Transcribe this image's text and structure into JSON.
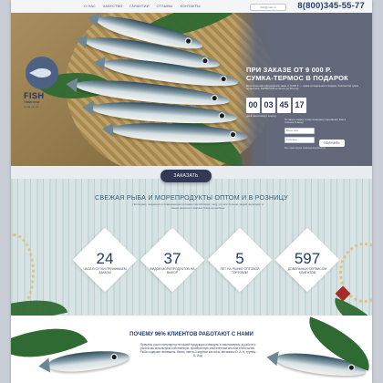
{
  "nav": [
    "О НАС",
    "КАЧЕСТВО",
    "ГАРАНТИИ",
    "ОТЗЫВЫ",
    "КОНТАКТЫ"
  ],
  "header": {
    "email": "fish@mail.ru",
    "phone": "8(800)345-55-77"
  },
  "logo": {
    "title": "FISH",
    "subtitle": "Навигатор",
    "tagline": "рыба оптом"
  },
  "offer": {
    "title_line1": "ПРИ ЗАКАЗЕ ОТ 9 000 Р.",
    "title_line2": "СУМКА-ТЕРМОС В ПОДАРОК",
    "text": "Всем клиентам оформившим заказ от 9 000 Р. — сумка-холодильник в подарок. Количество сумок ограничено. ТЕРМОСОВ осталось до 26 штук",
    "timer": [
      "00",
      "03",
      "45",
      "17"
    ],
    "timer_caption": "дней   часов   минут   секунд"
  },
  "form": {
    "note": "Оставьте заявку и наш менеджер перезвонит вам в течение 5 минут",
    "name_placeholder": "Ваше имя",
    "phone_placeholder": "Телефон",
    "submit": "ПОЛУЧИТЬ",
    "hint": "Мы гарантируем конфиденциальность"
  },
  "order_button": "ЗАКАЗАТЬ",
  "section": {
    "title": "СВЕЖАЯ РЫБА И МОРЕПРОДУКТЫ ОПТОМ И В РОЗНИЦУ",
    "subtitle": "Последние тенденции в современном питании способствуют тому, что все больше людей переходят в своем рационе с мясных блюд на рыбные"
  },
  "stats": [
    {
      "number": "24",
      "label": "часа в сутки принимаем заказы"
    },
    {
      "number": "37",
      "label": "видов морепродуктов на выбор"
    },
    {
      "number": "5",
      "label": "лет на рынке оптовой торговли"
    },
    {
      "number": "597",
      "label": "довольных сервисом клиентов"
    }
  ],
  "bottom": {
    "title": "ПОЧЕМУ 96% КЛИЕНТОВ РАБОТАЮТ С НАМИ",
    "text": "Причины роста популярности нашей продукции очевидны и закономерны: в работе с рыбой мы используем собственную, проверенную многолетним опытом технологию. Рыба содержит витамины, белки, омега-3 жирные кислоты, витамины D, A, K, группы B, йод"
  },
  "colors": {
    "brand_dark": "#233c72",
    "hero_panel": "#62687a",
    "order_button": "#313a54",
    "wood": "#d4e2e3"
  }
}
